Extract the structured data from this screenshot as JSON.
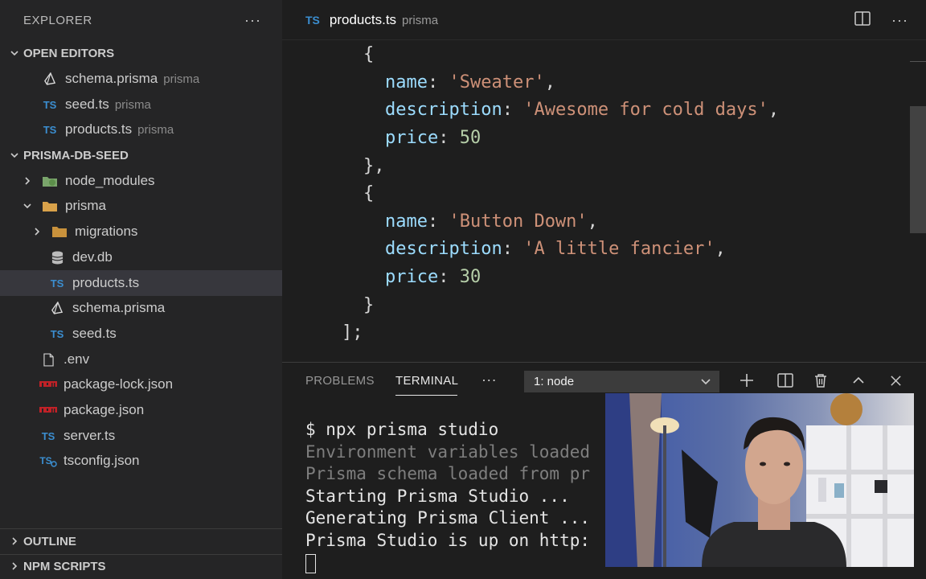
{
  "sidebar": {
    "title": "EXPLORER",
    "more": "···",
    "open_editors": {
      "label": "OPEN EDITORS",
      "items": [
        {
          "name": "schema.prisma",
          "folder": "prisma",
          "icon": "prisma-icon"
        },
        {
          "name": "seed.ts",
          "folder": "prisma",
          "icon": "TS"
        },
        {
          "name": "products.ts",
          "folder": "prisma",
          "icon": "TS"
        }
      ]
    },
    "project": {
      "label": "PRISMA-DB-SEED",
      "items": [
        {
          "name": "node_modules"
        },
        {
          "name": "prisma"
        },
        {
          "name": "migrations"
        },
        {
          "name": "dev.db"
        },
        {
          "name": "products.ts"
        },
        {
          "name": "schema.prisma"
        },
        {
          "name": "seed.ts"
        },
        {
          "name": ".env"
        },
        {
          "name": "package-lock.json"
        },
        {
          "name": "package.json"
        },
        {
          "name": "server.ts"
        },
        {
          "name": "tsconfig.json"
        }
      ]
    },
    "outline": "OUTLINE",
    "npm_scripts": "NPM SCRIPTS",
    "ts_badge": "TS"
  },
  "editor": {
    "tab": {
      "icon": "TS",
      "name": "products.ts",
      "folder": "prisma"
    },
    "code": {
      "l1": "{",
      "name_key": "name",
      "desc_key": "description",
      "price_key": "price",
      "colon": ": ",
      "comma": ",",
      "item1_name": "'Sweater'",
      "item1_desc": "'Awesome for cold days'",
      "item1_price": "50",
      "close_comma": "},",
      "item2_name": "'Button Down'",
      "item2_desc": "'A little fancier'",
      "item2_price": "30",
      "close": "}",
      "array_close": "];"
    }
  },
  "panel": {
    "tabs": [
      "PROBLEMS",
      "TERMINAL",
      "···"
    ],
    "terminal_select": "1: node",
    "terminal_lines": [
      "$ npx prisma studio",
      "Environment variables loaded",
      "Prisma schema loaded from pr",
      "Starting Prisma Studio ...",
      "Generating Prisma Client ...",
      "Prisma Studio is up on http:"
    ]
  },
  "colors": {
    "ts_blue": "#3b8ed0",
    "string": "#ce9178",
    "property": "#9cdcfe",
    "number": "#b5cea8"
  }
}
